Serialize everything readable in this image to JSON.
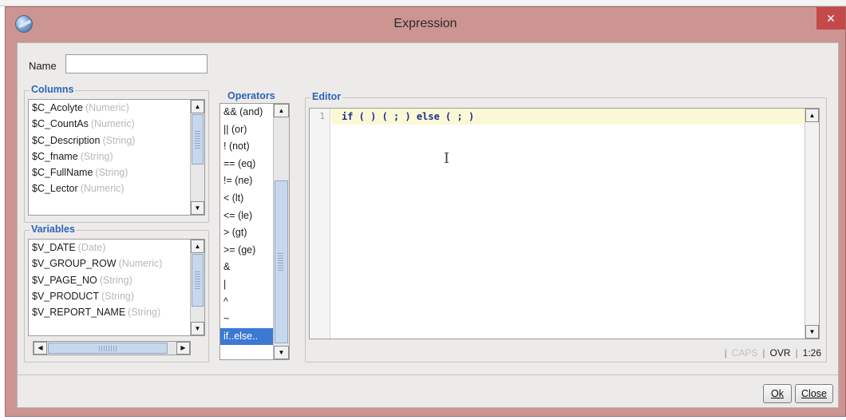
{
  "window": {
    "title": "Expression",
    "close_glyph": "✕"
  },
  "name_field": {
    "label": "Name",
    "value": ""
  },
  "columns": {
    "title": "Columns",
    "items": [
      {
        "name": "$C_Acolyte",
        "type": "(Numeric)"
      },
      {
        "name": "$C_CountAs",
        "type": "(Numeric)"
      },
      {
        "name": "$C_Description",
        "type": "(String)"
      },
      {
        "name": "$C_fname",
        "type": "(String)"
      },
      {
        "name": "$C_FullName",
        "type": "(String)"
      },
      {
        "name": "$C_Lector",
        "type": "(Numeric)"
      }
    ]
  },
  "variables": {
    "title": "Variables",
    "items": [
      {
        "name": "$V_DATE",
        "type": "(Date)"
      },
      {
        "name": "$V_GROUP_ROW",
        "type": "(Numeric)"
      },
      {
        "name": "$V_PAGE_NO",
        "type": "(String)"
      },
      {
        "name": "$V_PRODUCT",
        "type": "(String)"
      },
      {
        "name": "$V_REPORT_NAME",
        "type": "(String)"
      }
    ]
  },
  "operators": {
    "title": "Operators",
    "items": [
      "&& (and)",
      "|| (or)",
      "! (not)",
      "== (eq)",
      "!= (ne)",
      "< (lt)",
      "<= (le)",
      "> (gt)",
      ">= (ge)",
      "&",
      "|",
      "^",
      "~",
      "if..else.."
    ],
    "selected": "if..else.."
  },
  "editor": {
    "title": "Editor",
    "line_number": "1",
    "code": "if ( ) ( ; ) else ( ; )"
  },
  "statusbar": {
    "caps": "CAPS",
    "mode": "OVR",
    "position": "1:26"
  },
  "buttons": {
    "ok": "Ok",
    "close": "Close"
  },
  "colors": {
    "titlebar": "#cd9592",
    "group_title": "#2e63b8",
    "selection": "#3c79d3",
    "current_line": "#fbf8d6",
    "code_text": "#1f2e8f"
  },
  "icons": {
    "app": "expression-app-icon",
    "close": "close-icon",
    "scroll_up": "arrow-up-icon",
    "scroll_down": "arrow-down-icon",
    "scroll_left": "arrow-left-icon",
    "scroll_right": "arrow-right-icon"
  }
}
